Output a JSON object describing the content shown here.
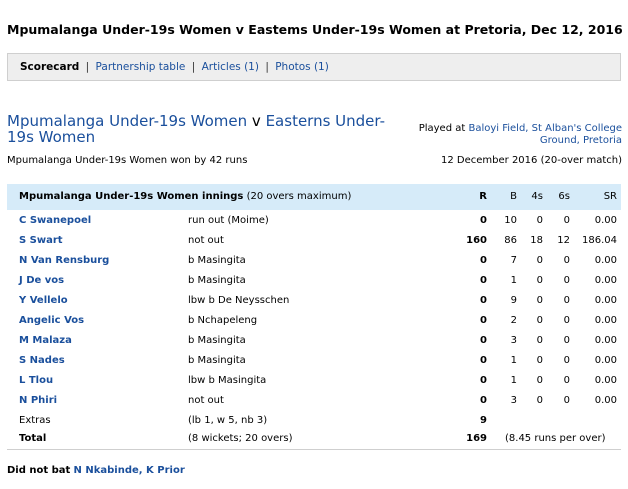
{
  "page_title": "Mpumalanga Under-19s Women v Eastems Under-19s Women at Pretoria, Dec 12, 2016",
  "tabs": {
    "active": "Scorecard",
    "links": [
      "Partnership table",
      "Articles (1)",
      "Photos (1)"
    ],
    "separator": "|"
  },
  "match": {
    "team1": "Mpumalanga Under-19s Women",
    "vs": "v",
    "team2": "Easterns Under-19s Women",
    "played_at_label": "Played at",
    "venue": "Baloyi Field, St Alban's College Ground, Pretoria",
    "result": "Mpumalanga Under-19s Women won by 42 runs",
    "date": "12 December 2016 (20-over match)"
  },
  "innings": {
    "title": "Mpumalanga Under-19s Women innings",
    "subtitle": "(20 overs maximum)",
    "columns": {
      "r": "R",
      "b": "B",
      "fours": "4s",
      "sixes": "6s",
      "sr": "SR"
    },
    "batters": [
      {
        "name": "C Swanepoel",
        "dismissal": "run out (Moime)",
        "r": "0",
        "b": "10",
        "fours": "0",
        "sixes": "0",
        "sr": "0.00"
      },
      {
        "name": "S Swart",
        "dismissal": "not out",
        "r": "160",
        "b": "86",
        "fours": "18",
        "sixes": "12",
        "sr": "186.04"
      },
      {
        "name": "N Van Rensburg",
        "dismissal": "b Masingita",
        "r": "0",
        "b": "7",
        "fours": "0",
        "sixes": "0",
        "sr": "0.00"
      },
      {
        "name": "J De vos",
        "dismissal": "b Masingita",
        "r": "0",
        "b": "1",
        "fours": "0",
        "sixes": "0",
        "sr": "0.00"
      },
      {
        "name": "Y Vellelo",
        "dismissal": "lbw b De Neysschen",
        "r": "0",
        "b": "9",
        "fours": "0",
        "sixes": "0",
        "sr": "0.00"
      },
      {
        "name": "Angelic Vos",
        "dismissal": "b Nchapeleng",
        "r": "0",
        "b": "2",
        "fours": "0",
        "sixes": "0",
        "sr": "0.00"
      },
      {
        "name": "M Malaza",
        "dismissal": "b Masingita",
        "r": "0",
        "b": "3",
        "fours": "0",
        "sixes": "0",
        "sr": "0.00"
      },
      {
        "name": "S Nades",
        "dismissal": "b Masingita",
        "r": "0",
        "b": "1",
        "fours": "0",
        "sixes": "0",
        "sr": "0.00"
      },
      {
        "name": "L Tlou",
        "dismissal": "lbw b Masingita",
        "r": "0",
        "b": "1",
        "fours": "0",
        "sixes": "0",
        "sr": "0.00"
      },
      {
        "name": "N Phiri",
        "dismissal": "not out",
        "r": "0",
        "b": "3",
        "fours": "0",
        "sixes": "0",
        "sr": "0.00"
      }
    ],
    "extras": {
      "label": "Extras",
      "detail": "(lb 1, w 5, nb 3)",
      "value": "9"
    },
    "total": {
      "label": "Total",
      "detail": "(8 wickets; 20 overs)",
      "value": "169",
      "rate": "(8.45 runs per over)"
    },
    "did_not_bat": {
      "label": "Did not bat",
      "players": "N Nkabinde, K Prior"
    }
  }
}
